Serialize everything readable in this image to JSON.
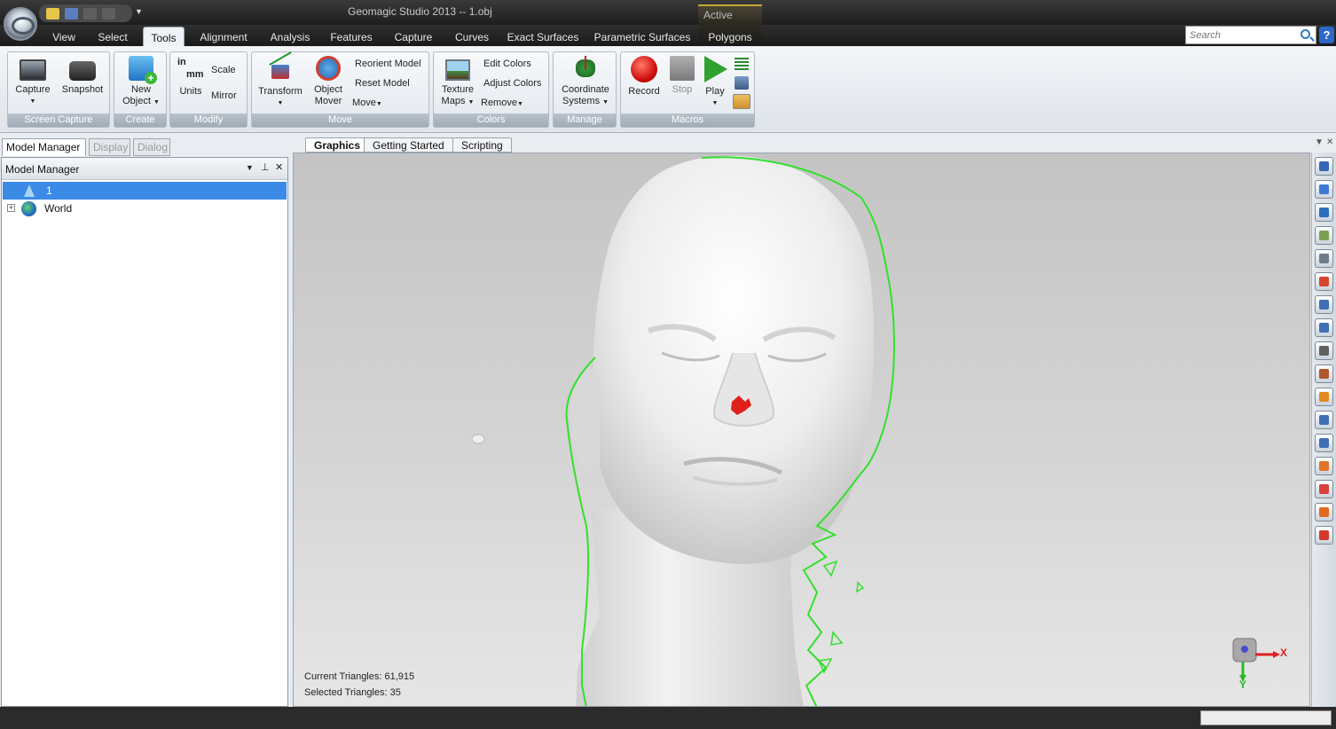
{
  "window": {
    "title": "Geomagic Studio 2013 -- 1.obj",
    "context_header": "Active"
  },
  "tabs": [
    {
      "label": "View",
      "active": false
    },
    {
      "label": "Select",
      "active": false
    },
    {
      "label": "Tools",
      "active": true
    },
    {
      "label": "Alignment",
      "active": false
    },
    {
      "label": "Analysis",
      "active": false
    },
    {
      "label": "Features",
      "active": false
    },
    {
      "label": "Capture",
      "active": false
    },
    {
      "label": "Curves",
      "active": false
    },
    {
      "label": "Exact Surfaces",
      "active": false
    },
    {
      "label": "Parametric Surfaces",
      "active": false
    },
    {
      "label": "Polygons",
      "active": false
    }
  ],
  "search": {
    "placeholder": "Search"
  },
  "help": {
    "label": "?"
  },
  "ribbon": {
    "screen_capture": {
      "label": "Screen Capture",
      "capture": "Capture",
      "snapshot": "Snapshot"
    },
    "create": {
      "label": "Create",
      "new_object_1": "New",
      "new_object_2": "Object"
    },
    "modify": {
      "label": "Modify",
      "units": "Units",
      "scale": "Scale",
      "mirror": "Mirror",
      "unit_in": "in",
      "unit_mm": "mm"
    },
    "move": {
      "label": "Move",
      "transform": "Transform",
      "object_mover_1": "Object",
      "object_mover_2": "Mover",
      "reorient": "Reorient Model",
      "reset": "Reset Model",
      "move": "Move"
    },
    "colors": {
      "label": "Colors",
      "texture_1": "Texture",
      "texture_2": "Maps",
      "edit": "Edit Colors",
      "adjust": "Adjust Colors",
      "remove": "Remove"
    },
    "manage": {
      "label": "Manage",
      "coord_1": "Coordinate",
      "coord_2": "Systems"
    },
    "macros": {
      "label": "Macros",
      "record": "Record",
      "stop": "Stop",
      "play": "Play"
    }
  },
  "panel_tabs": [
    "Model Manager",
    "Display",
    "Dialog"
  ],
  "model_manager": {
    "title": "Model Manager",
    "items": [
      {
        "label": "1",
        "selected": true
      },
      {
        "label": "World",
        "selected": false
      }
    ]
  },
  "doc_tabs": [
    "Graphics",
    "Getting Started",
    "Scripting"
  ],
  "viewport": {
    "current_triangles": "Current Triangles: 61,915",
    "selected_triangles": "Selected Triangles: 35",
    "triad_x": "X",
    "triad_y": "Y"
  },
  "right_toolbar": {
    "icons": [
      "model-view-icon",
      "rotate-icon",
      "fit-view-icon",
      "background-icon",
      "zoom-icon",
      "render-icon",
      "rect-select-icon",
      "lasso-select-icon",
      "line-select-icon",
      "paint-select-icon",
      "select-through-icon",
      "select-all-icon",
      "select-visible-icon",
      "select-connected-icon",
      "select-manifold-icon",
      "select-by-curvature-icon",
      "select-edge-icon"
    ],
    "colors": [
      "#3566b8",
      "#3c7ad6",
      "#2c6ec0",
      "#7aa052",
      "#6d7c8a",
      "#d4452a",
      "#3f6fb5",
      "#3f6fb5",
      "#606060",
      "#b0562b",
      "#e08a20",
      "#3f6fb5",
      "#3f6fb5",
      "#e2742a",
      "#d9423a",
      "#e06a20",
      "#d33a2c"
    ]
  },
  "colors": {
    "accent": "#3b8ae6",
    "outline": "#33e02b",
    "selection": "#e0201a",
    "mesh": "#f4f4f4"
  }
}
